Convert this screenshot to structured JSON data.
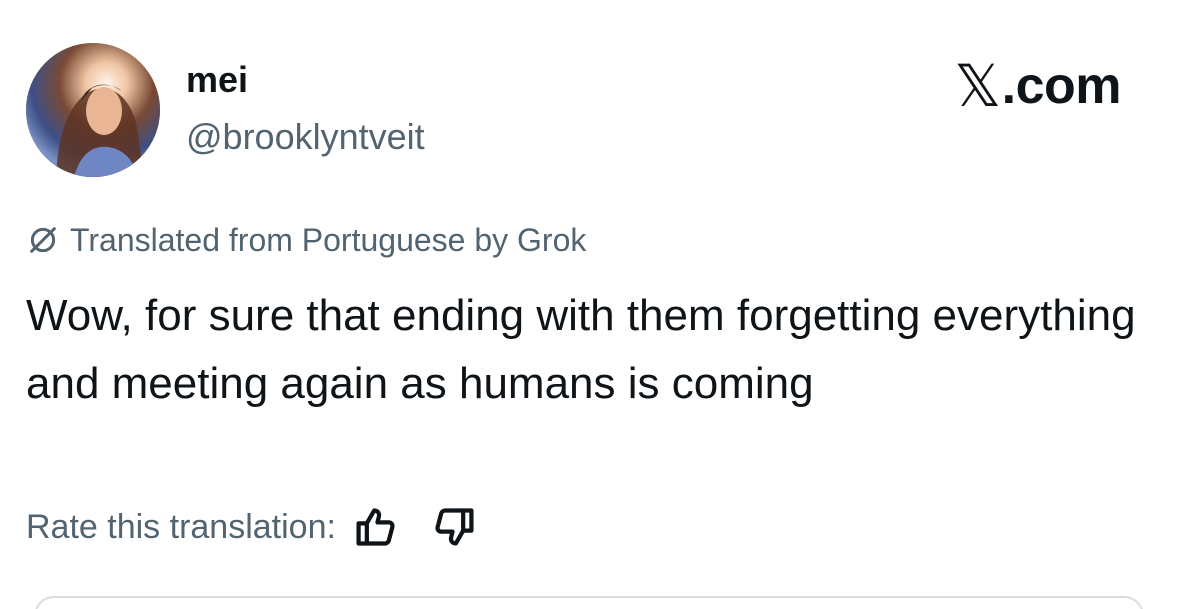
{
  "author": {
    "name": "mei",
    "handle": "@brooklyntveit",
    "avatar_icon": "profile-photo"
  },
  "brand": {
    "x_glyph": "𝕏",
    "suffix": ".com"
  },
  "translation": {
    "icon": "grok-icon",
    "notice": "Translated from Portuguese by Grok"
  },
  "tweet": {
    "text": "Wow, for sure that ending with them forgetting everything and meeting again as humans is coming"
  },
  "rating": {
    "label": "Rate this translation:",
    "thumbs_up_icon": "thumbs-up-icon",
    "thumbs_down_icon": "thumbs-down-icon"
  },
  "colors": {
    "text_primary": "#0f1419",
    "text_secondary": "#536471",
    "background": "#ffffff"
  }
}
